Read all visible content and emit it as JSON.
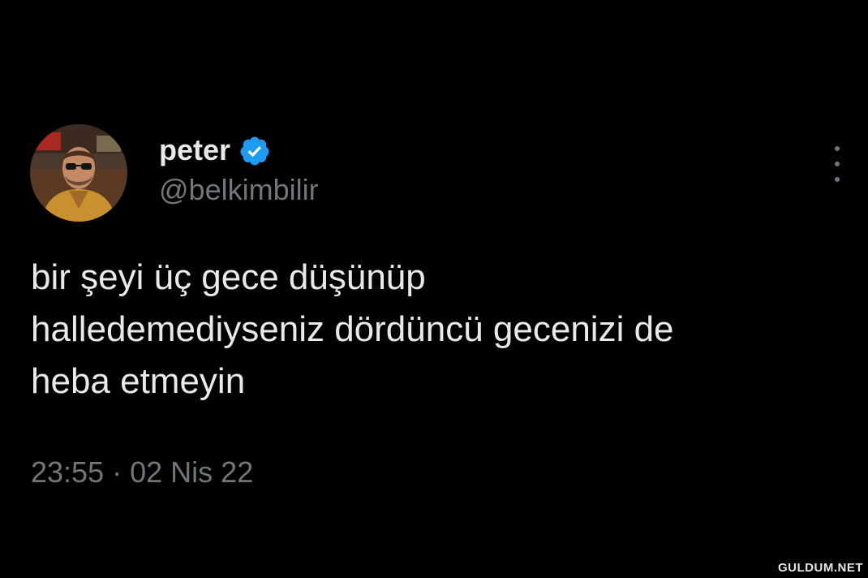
{
  "tweet": {
    "display_name": "peter",
    "handle": "@belkimbilir",
    "verified": true,
    "text": "bir şeyi üç gece düşünüp\nhalledemediyseniz dördüncü gecenizi de\nheba etmeyin",
    "time": "23:55",
    "separator": "·",
    "date": "02 Nis 22"
  },
  "icons": {
    "verified": "verified-badge-icon",
    "more": "more-options-icon"
  },
  "colors": {
    "background": "#000000",
    "primary_text": "#e7e9ea",
    "secondary_text": "#71767b",
    "verified_blue": "#1d9bf0"
  },
  "watermark": "GULDUM.NET"
}
